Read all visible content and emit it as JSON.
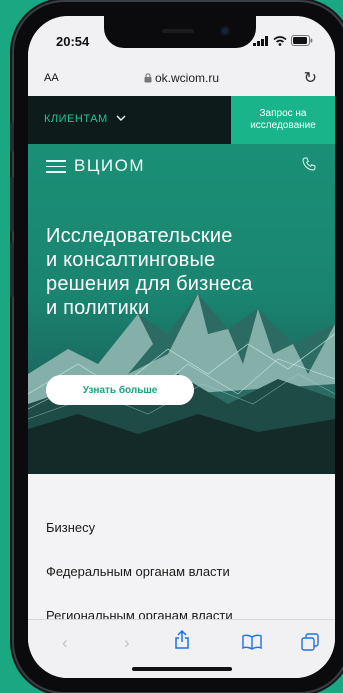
{
  "status": {
    "time": "20:54"
  },
  "browser": {
    "aa_label": "AA",
    "url": "ok.wciom.ru"
  },
  "site": {
    "clients_label": "КЛИЕНТАМ",
    "request_label_line1": "Запрос на",
    "request_label_line2": "исследование",
    "logo": "ВЦИОМ",
    "headline_lines": [
      "Исследовательские",
      "и консалтинговые",
      "решения для бизнеса",
      "и политики"
    ],
    "cta_label": "Узнать больше",
    "menu_items": [
      "Бизнесу",
      "Федеральным органам власти",
      "Региональным органам власти"
    ]
  },
  "colors": {
    "accent": "#19b48a",
    "background": "#1aa882",
    "dark_bar": "#0e1b1b"
  }
}
